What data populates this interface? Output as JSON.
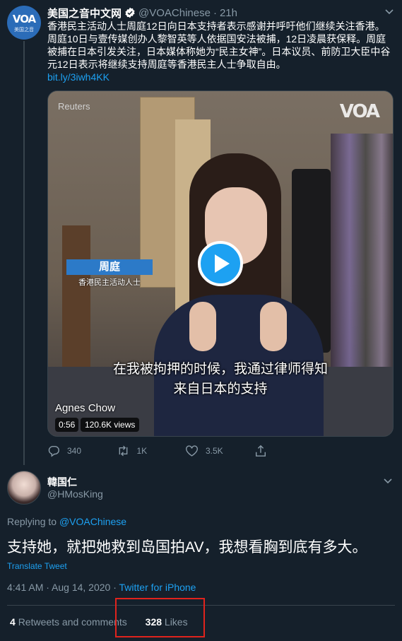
{
  "original_tweet": {
    "avatar_logo": "VOA",
    "avatar_sub": "美国之音",
    "name": "美国之音中文网",
    "handle": "@VOAChinese",
    "separator": "·",
    "time": "21h",
    "text": "香港民主活动人士周庭12日向日本支持者表示感谢并呼吁他们继续关注香港。周庭10日与壹传媒创办人黎智英等人依据国安法被捕，12日凌晨获保释。周庭被捕在日本引发关注，日本媒体称她为“民主女神”。日本议员、前防卫大臣中谷元12日表示将继续支持周庭等香港民主人士争取自由。",
    "link": "bit.ly/3iwh4KK",
    "media": {
      "watermark_left": "Reuters",
      "watermark_right": "VOA",
      "lower_third_name": "周庭",
      "lower_third_role": "香港民主活动人士",
      "subtitle_line1": "在我被拘押的时候，我通过律师得知",
      "subtitle_line2": "来自日本的支持",
      "caption_name": "Agnes Chow",
      "duration": "0:56",
      "views": "120.6K views"
    },
    "actions": {
      "replies": "340",
      "retweets": "1K",
      "likes": "3.5K"
    }
  },
  "reply_tweet": {
    "name": "韓国仁",
    "handle": "@HMosKing",
    "replying_prefix": "Replying to",
    "replying_to": "@VOAChinese",
    "text": "支持她，就把她救到岛国拍AV，我想看胸到底有多大。",
    "translate": "Translate Tweet",
    "timestamp": "4:41 AM · Aug 14, 2020 ·",
    "source": "Twitter for iPhone",
    "retweets_count": "4",
    "retweets_label": "Retweets and comments",
    "likes_count": "328",
    "likes_label": "Likes"
  },
  "colors": {
    "background": "#15202b",
    "accent": "#1da1f2",
    "muted": "#8899a6",
    "highlight_box": "#e0231d"
  },
  "icons": [
    "verified-badge-icon",
    "chevron-down-icon",
    "reply-icon",
    "retweet-icon",
    "like-icon",
    "share-icon",
    "play-icon"
  ]
}
